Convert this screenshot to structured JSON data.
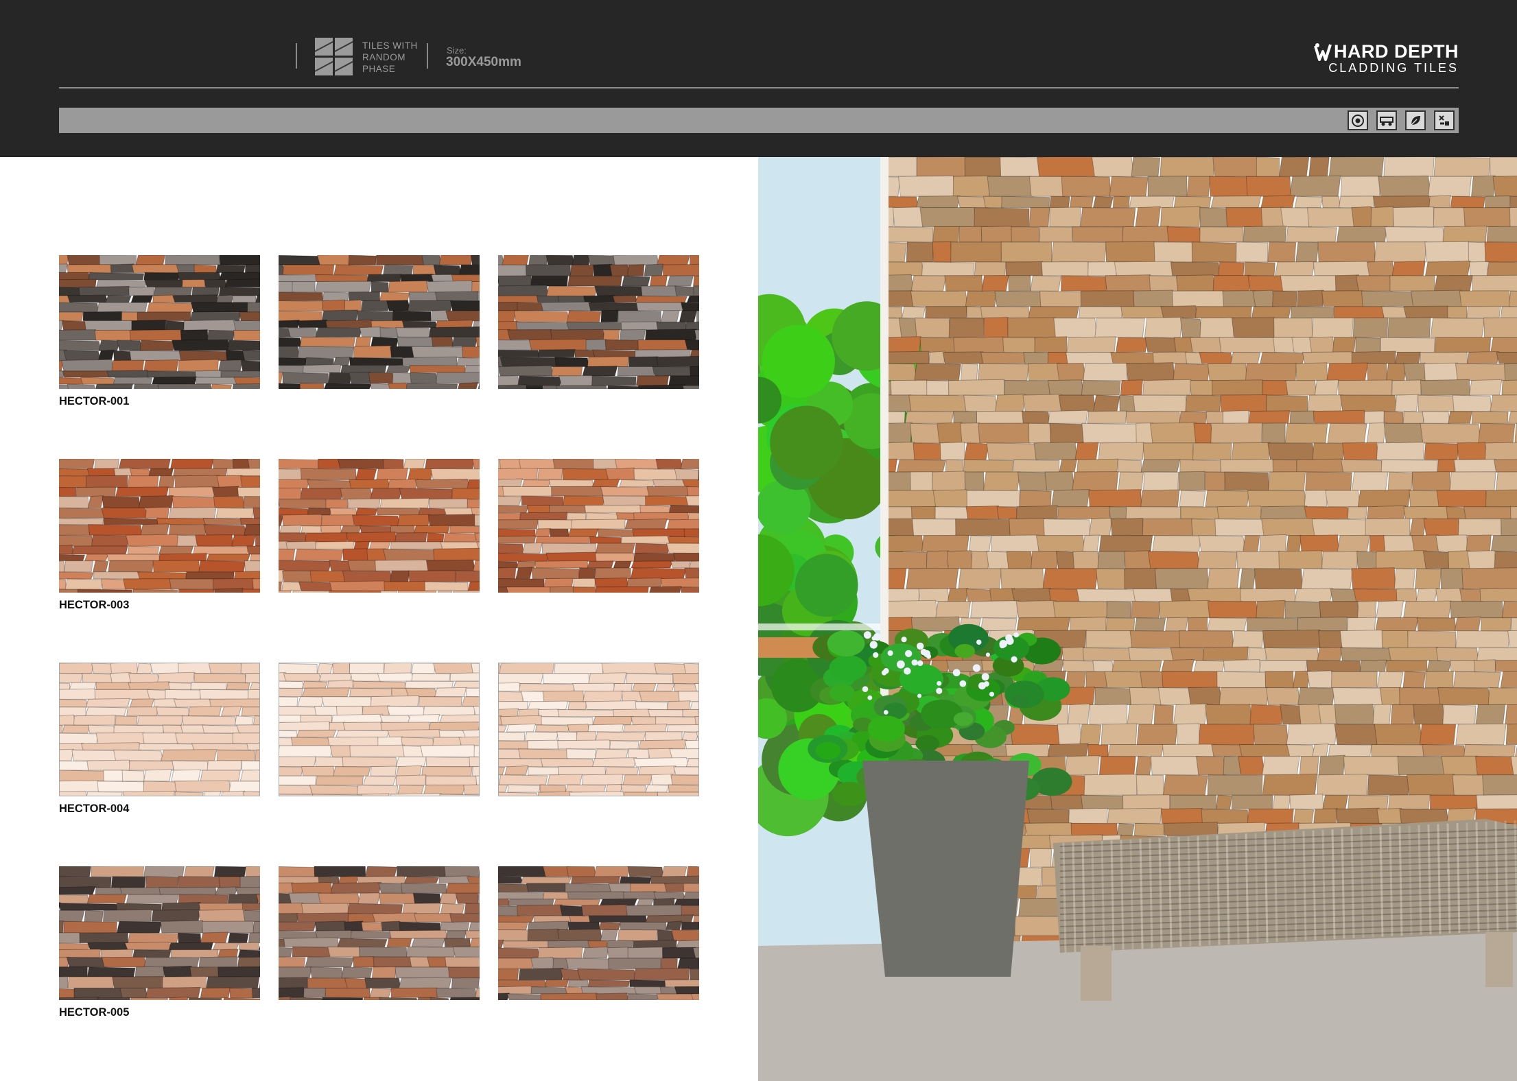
{
  "header": {
    "phase_icon": "tiles-random-phase-icon",
    "phase_text": [
      "TILES WITH",
      "RANDOM",
      "PHASE"
    ],
    "size_label": "Size:",
    "size_value": "300X450mm",
    "brand_name": "HARD DEPTH",
    "brand_subtitle": "CLADDING TILES",
    "feature_icons": [
      "glossy-finish-icon",
      "heavy-traffic-icon",
      "eco-friendly-icon",
      "installation-tools-icon"
    ]
  },
  "products": [
    {
      "code": "HECTOR-001",
      "palette": "dark",
      "colors": [
        "#3b3532",
        "#55504c",
        "#6c6560",
        "#8a8380",
        "#a19894",
        "#b5673d",
        "#c98256",
        "#7e4b33",
        "#2a2624"
      ]
    },
    {
      "code": "HECTOR-003",
      "palette": "terracotta",
      "colors": [
        "#c06535",
        "#d18159",
        "#e0a27f",
        "#b8542c",
        "#d9b49c",
        "#a85a3b",
        "#e8c2a4",
        "#b57553",
        "#8b4a2e"
      ]
    },
    {
      "code": "HECTOR-004",
      "palette": "light",
      "colors": [
        "#f3d9c8",
        "#efcfb9",
        "#f8e8dc",
        "#e9c1a6",
        "#fbefe5",
        "#f0d2bf",
        "#e5b99c",
        "#f6e0d1",
        "#ecc8b0"
      ]
    },
    {
      "code": "HECTOR-005",
      "palette": "mixed",
      "colors": [
        "#5b4a42",
        "#7a5a49",
        "#b06a45",
        "#c98c6a",
        "#8e7b72",
        "#a6938a",
        "#3e3431",
        "#cfa083",
        "#966049"
      ]
    }
  ],
  "photo": {
    "wall_colors": [
      "#c9a071",
      "#b98655",
      "#d6b693",
      "#c4753f",
      "#ddc3a4",
      "#b0926e",
      "#e0c9ae",
      "#a8784e",
      "#cfaa83",
      "#be8c5f"
    ],
    "sky_color": "#cfe6f0",
    "foliage_color": "#4a8a2a",
    "floor_color": "#bdb8b1",
    "planter_color": "#6e6f68",
    "bench_color": "#a39886"
  }
}
